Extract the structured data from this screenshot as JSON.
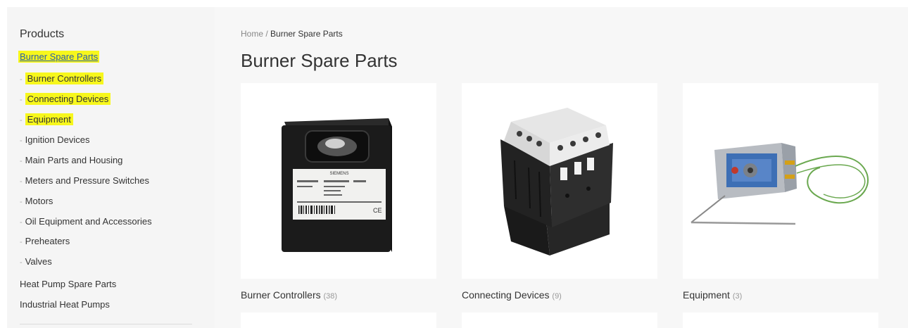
{
  "sidebar": {
    "title": "Products",
    "active_category": "Burner Spare Parts",
    "sub_dash": "-",
    "subcategories": [
      {
        "label": "Burner Controllers",
        "highlight": true
      },
      {
        "label": "Connecting Devices",
        "highlight": true
      },
      {
        "label": "Equipment",
        "highlight": true
      },
      {
        "label": "Ignition Devices",
        "highlight": false
      },
      {
        "label": "Main Parts and Housing",
        "highlight": false
      },
      {
        "label": "Meters and Pressure Switches",
        "highlight": false
      },
      {
        "label": "Motors",
        "highlight": false
      },
      {
        "label": "Oil Equipment and Accessories",
        "highlight": false
      },
      {
        "label": "Preheaters",
        "highlight": false
      },
      {
        "label": "Valves",
        "highlight": false
      }
    ],
    "other_categories": [
      "Heat Pump Spare Parts",
      "Industrial Heat Pumps"
    ]
  },
  "breadcrumb": {
    "home": "Home",
    "separator": " / ",
    "current": "Burner Spare Parts"
  },
  "page_title": "Burner Spare Parts",
  "products": [
    {
      "name": "Burner Controllers",
      "count": "(38)",
      "image": "burner-controller-image",
      "image_brand_text": "SIEMENS"
    },
    {
      "name": "Connecting Devices",
      "count": "(9)",
      "image": "contactor-image"
    },
    {
      "name": "Equipment",
      "count": "(3)",
      "image": "thermostat-image"
    }
  ],
  "colors": {
    "highlight": "#f7f71c",
    "link": "#2a5ea8",
    "sidebar_bg": "#f5f5f5",
    "main_bg": "#f7f7f7"
  }
}
